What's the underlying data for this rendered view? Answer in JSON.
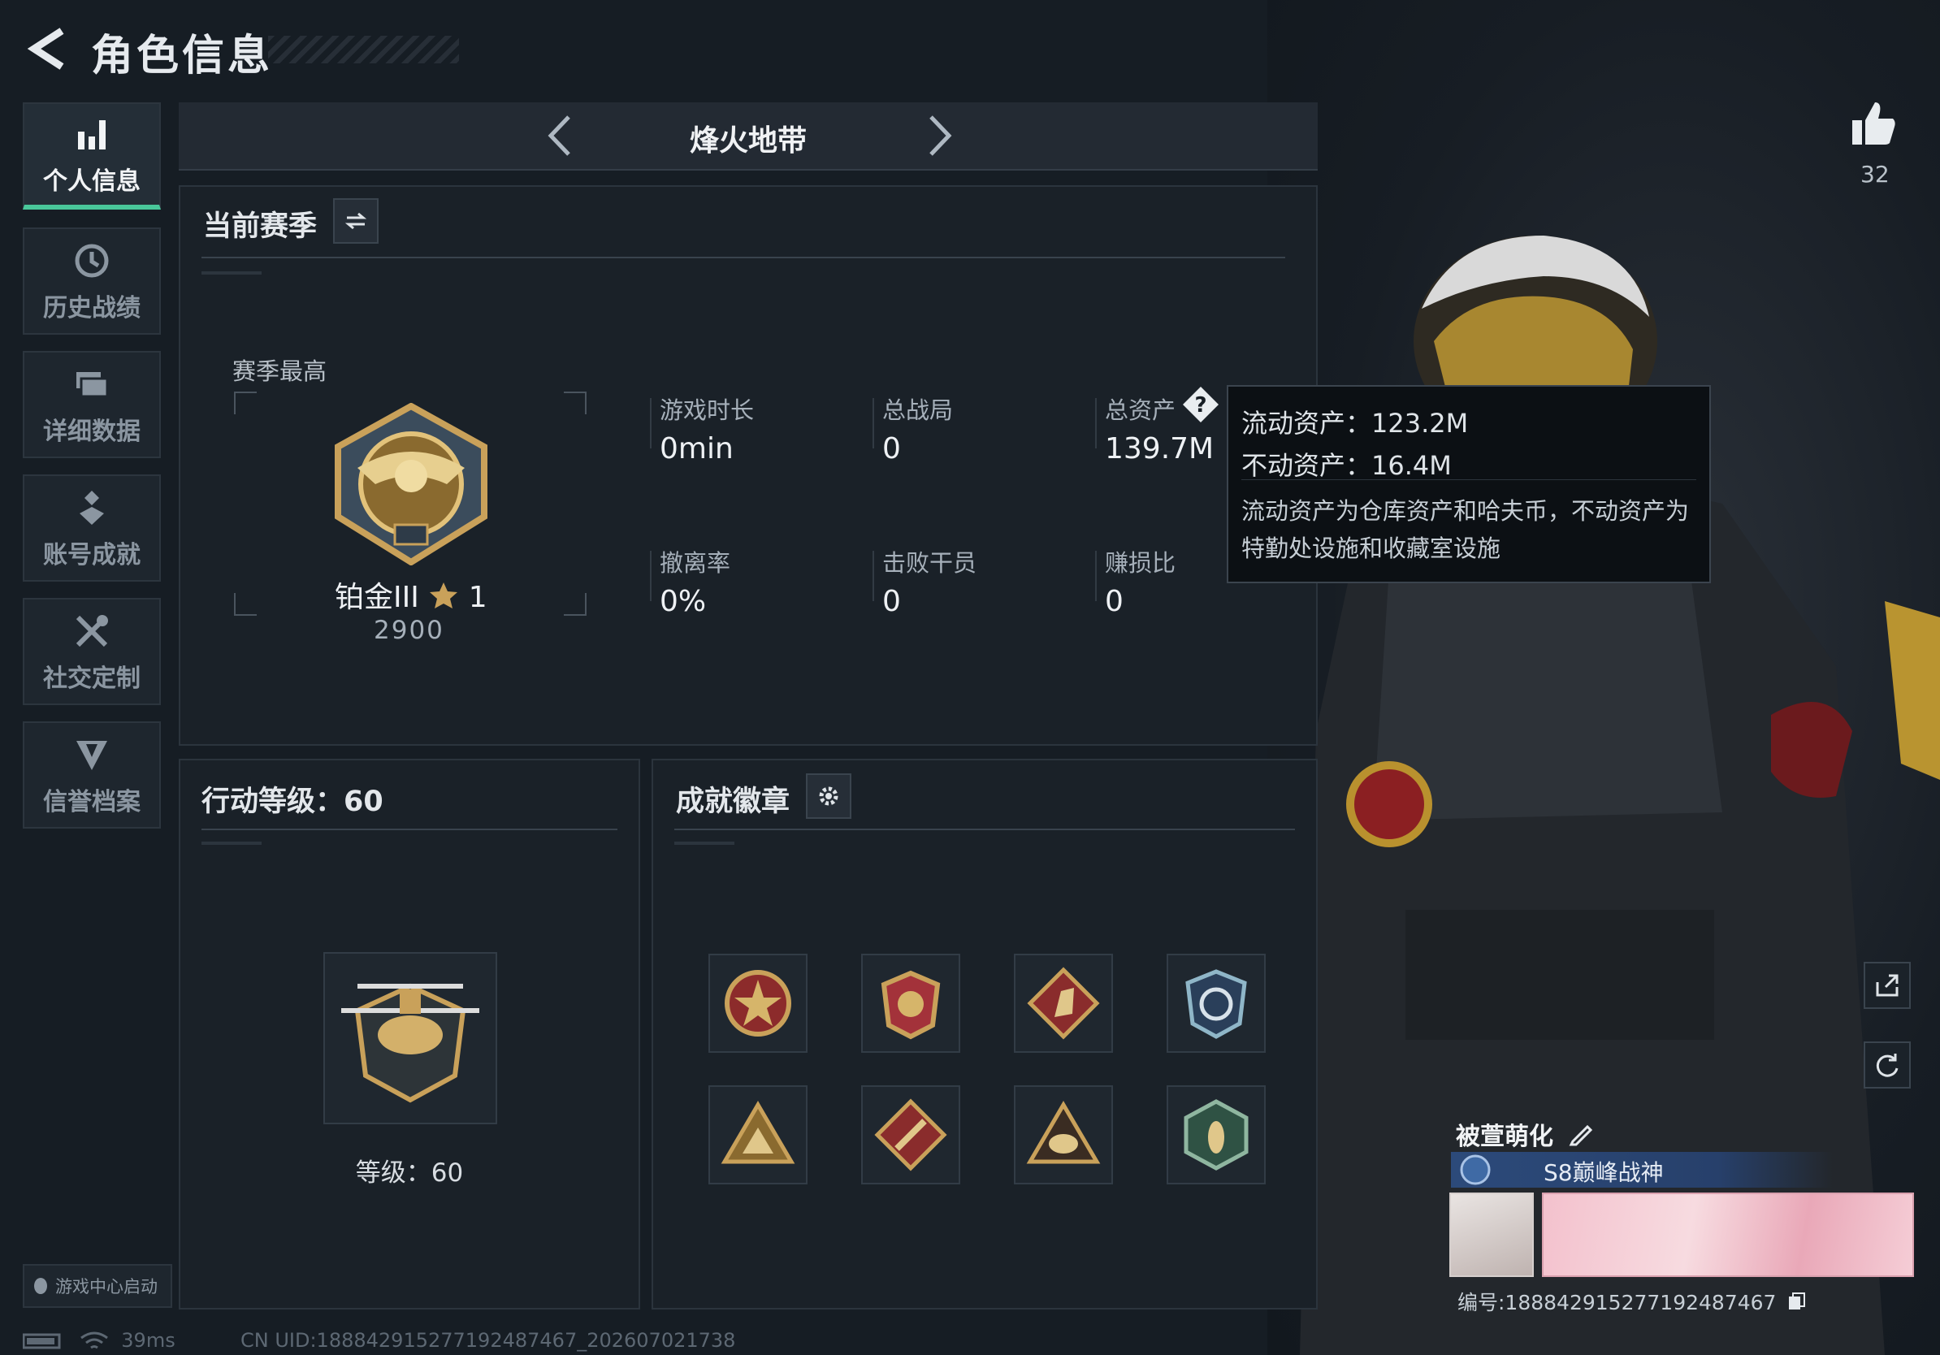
{
  "header": {
    "title": "角色信息"
  },
  "sidebar": {
    "items": [
      {
        "label": "个人信息",
        "icon": "bar-chart-icon",
        "active": true
      },
      {
        "label": "历史战绩",
        "icon": "clock-history-icon",
        "active": false
      },
      {
        "label": "详细数据",
        "icon": "folder-stack-icon",
        "active": false
      },
      {
        "label": "账号成就",
        "icon": "achievement-emblem-icon",
        "active": false
      },
      {
        "label": "社交定制",
        "icon": "tools-cross-icon",
        "active": false
      },
      {
        "label": "信誉档案",
        "icon": "shield-badge-icon",
        "active": false
      }
    ],
    "game_center_launch": "游戏中心启动"
  },
  "mode_switcher": {
    "title": "烽火地带"
  },
  "season_panel": {
    "heading": "当前赛季",
    "season_best_label": "赛季最高",
    "rank": {
      "name": "铂金III",
      "stars": "1",
      "points": "2900"
    },
    "stats": [
      {
        "label": "游戏时长",
        "value": "0min"
      },
      {
        "label": "总战局",
        "value": "0"
      },
      {
        "label": "总资产",
        "value": "139.7M"
      },
      {
        "label": "撤离率",
        "value": "0%"
      },
      {
        "label": "击败干员",
        "value": "0"
      },
      {
        "label": "赚损比",
        "value": "0"
      }
    ]
  },
  "tooltip": {
    "liquid": "流动资产：123.2M",
    "fixed": "不动资产：16.4M",
    "description": "流动资产为仓库资产和哈夫币，不动资产为特勤处设施和收藏室设施"
  },
  "action_level_panel": {
    "heading": "行动等级：60",
    "level_text": "等级：60"
  },
  "badges_panel": {
    "heading": "成就徽章",
    "badges": [
      {
        "icon": "star-medal-icon"
      },
      {
        "icon": "eagle-shield-icon"
      },
      {
        "icon": "horse-diamond-icon"
      },
      {
        "icon": "globe-shield-icon"
      },
      {
        "icon": "pyramid-triangle-icon"
      },
      {
        "icon": "wrench-diamond-icon"
      },
      {
        "icon": "helmet-triangle-icon"
      },
      {
        "icon": "wasp-hexagon-icon"
      }
    ]
  },
  "likes": {
    "count": "32"
  },
  "player_card": {
    "name": "被萱萌化",
    "title": "S8巅峰战神",
    "id": "编号:1888429152771924874​67"
  },
  "status": {
    "ping": "39ms",
    "uid": "CN UID:1888429152771924874​67_202607021738"
  },
  "colors": {
    "accent": "#49c79a",
    "background": "#161d24",
    "panel": "#1a2128",
    "gold": "#c9a15a"
  }
}
